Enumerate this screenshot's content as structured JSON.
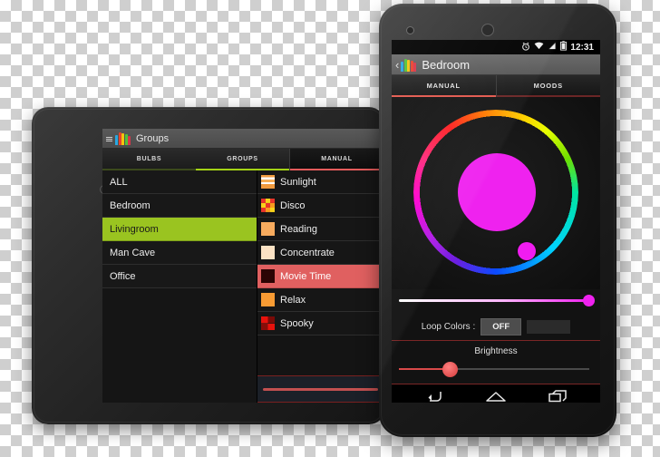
{
  "scene": {
    "description": "Android tablet and phone showing a Philips Hue style lighting control app",
    "accent_green": "#9ac420",
    "accent_red": "#e06060",
    "accent_magenta": "#ef22ef"
  },
  "tablet": {
    "actionbar": {
      "title": "Groups",
      "menu_icon": "hamburger-icon",
      "app_icon": "hue-bulb-icon"
    },
    "tabs": [
      {
        "label": "BULBS",
        "selected": false
      },
      {
        "label": "GROUPS",
        "selected": true
      },
      {
        "label": "MANUAL",
        "selected": true
      }
    ],
    "groups": [
      {
        "label": "ALL",
        "active": false
      },
      {
        "label": "Bedroom",
        "active": false
      },
      {
        "label": "Livingroom",
        "active": true
      },
      {
        "label": "Man Cave",
        "active": false
      },
      {
        "label": "Office",
        "active": false
      }
    ],
    "moods": [
      {
        "label": "Sunlight",
        "active": false,
        "swatch": "sunlight"
      },
      {
        "label": "Disco",
        "active": false,
        "swatch": "disco"
      },
      {
        "label": "Reading",
        "active": false,
        "swatch": "reading"
      },
      {
        "label": "Concentrate",
        "active": false,
        "swatch": "concentrate"
      },
      {
        "label": "Movie Time",
        "active": true,
        "swatch": "movie"
      },
      {
        "label": "Relax",
        "active": false,
        "swatch": "relax"
      },
      {
        "label": "Spooky",
        "active": false,
        "swatch": "spooky"
      }
    ],
    "nav": [
      {
        "icon": "back-icon"
      },
      {
        "icon": "home-icon"
      }
    ]
  },
  "phone": {
    "status_bar": {
      "time": "12:31",
      "icons": [
        "alarm-icon",
        "wifi-icon",
        "signal-icon",
        "battery-icon"
      ]
    },
    "actionbar": {
      "title": "Bedroom",
      "back_icon": "back-chevron-icon",
      "app_icon": "hue-bulb-icon"
    },
    "tabs": [
      {
        "label": "MANUAL",
        "selected": true
      },
      {
        "label": "MOODS",
        "selected": false
      }
    ],
    "color_wheel": {
      "selected_color": "#ef22ef",
      "knob_position_deg": 305
    },
    "saturation_slider": {
      "value_percent": 100
    },
    "loop_colors": {
      "label": "Loop Colors :",
      "state": "OFF"
    },
    "brightness": {
      "label": "Brightness",
      "value_percent": 28
    },
    "nav": [
      {
        "icon": "back-icon"
      },
      {
        "icon": "home-icon"
      },
      {
        "icon": "recents-icon"
      }
    ]
  }
}
